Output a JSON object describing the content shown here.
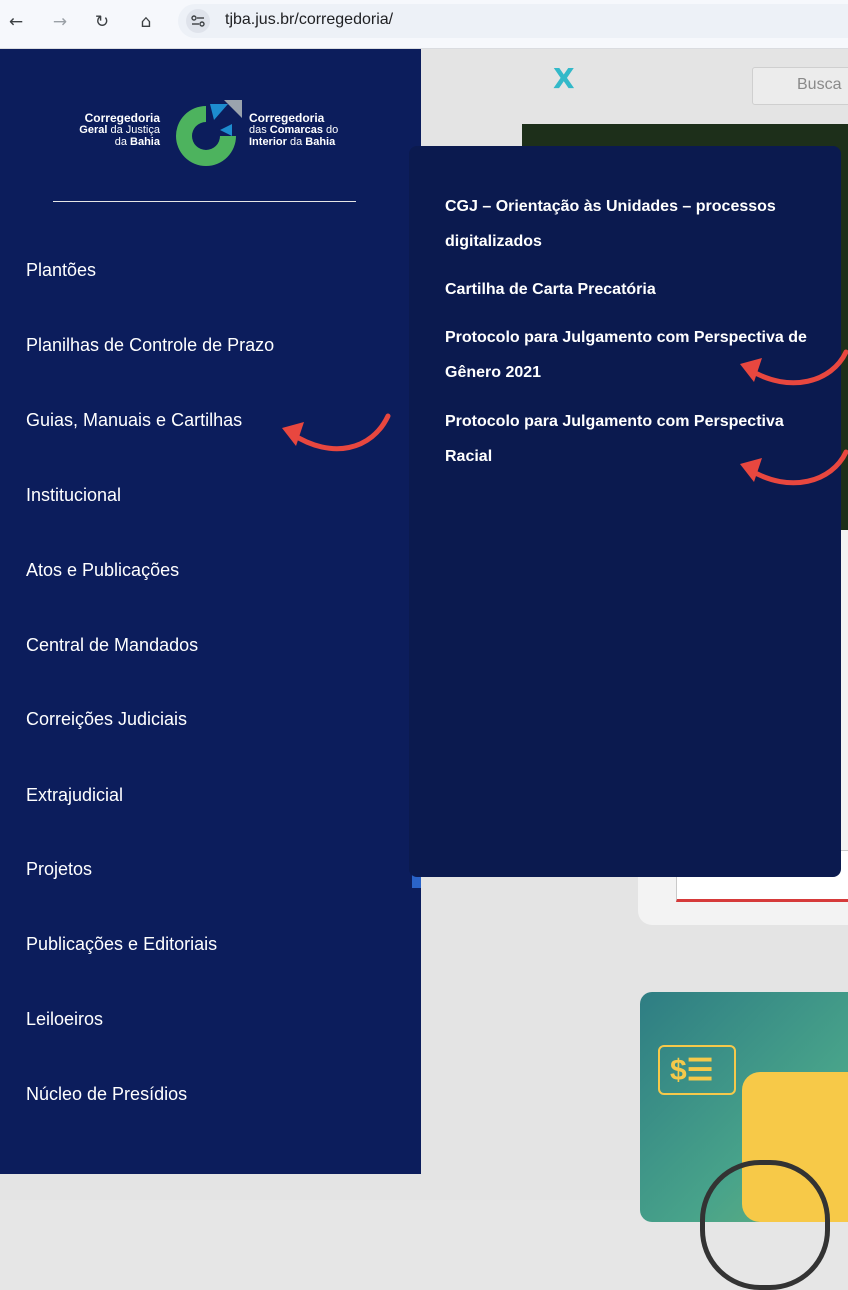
{
  "browser": {
    "url": "tjba.jus.br/corregedoria/",
    "back_icon": "←",
    "forward_icon": "→",
    "reload_icon": "↻",
    "home_icon": "⌂",
    "site_settings_icon": "tune-icon"
  },
  "header": {
    "close_label": "X",
    "search_placeholder": "Busca"
  },
  "logo": {
    "left": {
      "line1": "Corregedoria",
      "line2a": "Geral",
      "line2b": " da Justiça",
      "line3a": "da ",
      "line3b": "Bahia"
    },
    "right": {
      "line1": "Corregedoria",
      "line2a": "das ",
      "line2b": "Comarcas",
      "line2c": " do",
      "line3a": "Interior",
      "line3b": " da ",
      "line3c": "Bahia"
    },
    "colors": {
      "green": "#4db35e",
      "blue": "#1d8ccf",
      "gray": "#9aa3ad"
    }
  },
  "sidebar": {
    "items": [
      {
        "label": "Plantões"
      },
      {
        "label": "Planilhas de Controle de Prazo"
      },
      {
        "label": "Guias, Manuais e Cartilhas"
      },
      {
        "label": "Institucional"
      },
      {
        "label": "Atos e Publicações"
      },
      {
        "label": "Central de Mandados"
      },
      {
        "label": "Correições Judiciais"
      },
      {
        "label": "Extrajudicial"
      },
      {
        "label": "Projetos"
      },
      {
        "label": "Publicações e Editoriais"
      },
      {
        "label": "Leiloeiros"
      },
      {
        "label": "Núcleo de Presídios"
      }
    ]
  },
  "submenu": {
    "items": [
      {
        "label": "CGJ – Orientação às Unidades – processos digitalizados"
      },
      {
        "label": "Cartilha de Carta Precatória"
      },
      {
        "label": "Protocolo para Julgamento com Perspectiva de Gênero 2021"
      },
      {
        "label": "Protocolo para Julgamento com Perspectiva Racial"
      }
    ]
  },
  "background": {
    "promo_symbol": "$☰"
  },
  "colors": {
    "sidebar_bg": "#0c1d5c",
    "submenu_bg": "#0b1a4f",
    "close_x": "#33b9c9",
    "annotation_arrow": "#e8473f"
  }
}
